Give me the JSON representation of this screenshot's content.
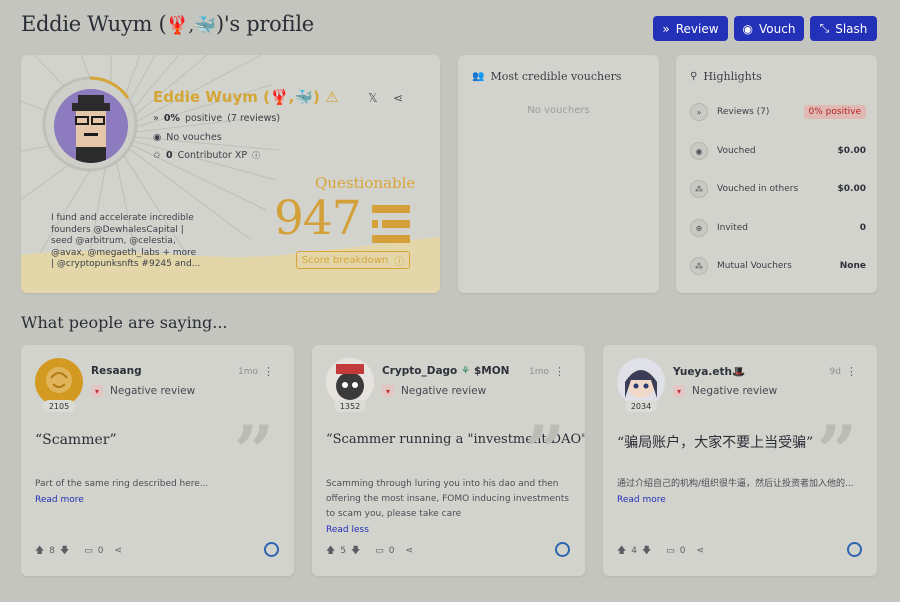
{
  "header": {
    "title_prefix": "Eddie Wuym (",
    "title_emoji": "🦞,🐳",
    "title_suffix": ")'s profile",
    "buttons": {
      "review": "Review",
      "vouch": "Vouch",
      "slash": "Slash"
    }
  },
  "profile": {
    "name": "Eddie Wuym (🦞,🐳)",
    "warning_icon": "⚠",
    "stats": {
      "positive_pct": "0%",
      "positive_text": "positive",
      "reviews": "(7 reviews)",
      "vouches": "No vouches",
      "xp_value": "0",
      "xp_label": "Contributor XP"
    },
    "bio": "I fund and accelerate incredible founders @DewhalesCapital | seed @arbitrum, @celestia, @avax, @megaeth_labs + more | @cryptopunksnfts #9245 and...",
    "credibility": "Questionable",
    "score": "947",
    "breakdown_label": "Score breakdown"
  },
  "vouchers": {
    "title": "Most credible vouchers",
    "empty": "No vouchers"
  },
  "highlights": {
    "title": "Highlights",
    "rows": [
      {
        "label": "Reviews (7)",
        "value": "0% positive",
        "icon": "review-icon"
      },
      {
        "label": "Vouched",
        "value": "$0.00",
        "icon": "vouch-icon"
      },
      {
        "label": "Vouched in others",
        "value": "$0.00",
        "icon": "people-icon"
      },
      {
        "label": "Invited",
        "value": "0",
        "icon": "invite-icon"
      },
      {
        "label": "Mutual Vouchers",
        "value": "None",
        "icon": "mutual-icon"
      }
    ]
  },
  "section_title": "What people are saying...",
  "reviews": [
    {
      "author": "Resaang",
      "time": "1mo",
      "score": "2105",
      "type": "Negative review",
      "title": "“Scammer”",
      "body": "Part of the same ring described here...",
      "link": "Read more",
      "upvotes": "8",
      "comments": "0"
    },
    {
      "author": "Crypto_Dago",
      "author_tag": "$MON",
      "time": "1mo",
      "score": "1352",
      "type": "Negative review",
      "title": "“Scammer running a \"investment DAO\"”",
      "body": "Scamming through luring you into his dao and then offering the most insane, FOMO inducing investments to scam you, please take care",
      "link": "Read less",
      "upvotes": "5",
      "comments": "0"
    },
    {
      "author": "Yueya.eth",
      "author_tag": "🎩",
      "time": "9d",
      "score": "2034",
      "type": "Negative review",
      "title": "“骗局账户，大家不要上当受骗”",
      "body": "通过介绍自己的机构/组织很牛逼，然后让投资者加入他的...",
      "link": "Read more",
      "upvotes": "4",
      "comments": "0"
    }
  ],
  "colors": {
    "accent": "#2330b8",
    "gold": "#d3a636",
    "negative": "#b42525",
    "background": "#c5c5bf"
  }
}
